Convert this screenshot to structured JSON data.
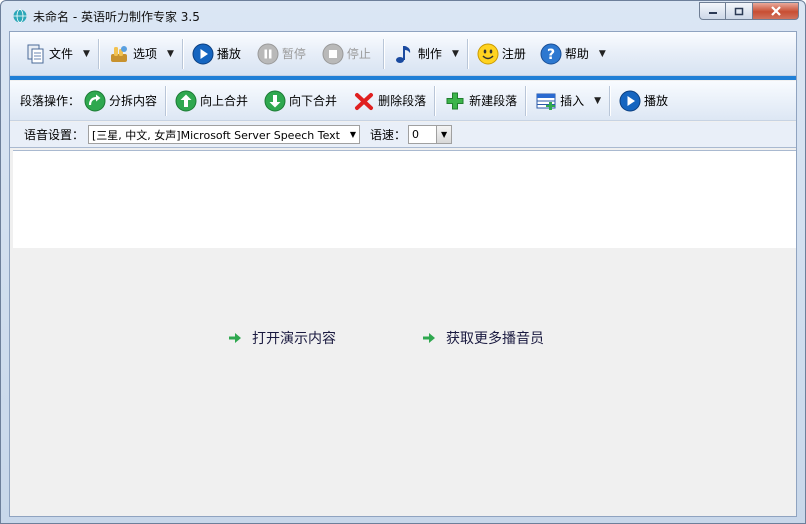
{
  "window": {
    "title": "未命名 - 英语听力制作专家 3.5"
  },
  "toolbar_main": {
    "file": "文件",
    "options": "选项",
    "play": "播放",
    "pause": "暂停",
    "stop": "停止",
    "make": "制作",
    "register": "注册",
    "help": "帮助"
  },
  "toolbar_paragraph": {
    "label": "段落操作：",
    "split": "分拆内容",
    "merge_up": "向上合并",
    "merge_down": "向下合并",
    "delete": "删除段落",
    "new": "新建段落",
    "insert": "插入",
    "play": "播放"
  },
  "voice_settings": {
    "label": "语音设置：",
    "voice_value": "[三星, 中文, 女声]Microsoft Server Speech Text to",
    "speed_label": "语速：",
    "speed_value": "0"
  },
  "links": {
    "open_demo": "打开演示内容",
    "more_voices": "获取更多播音员"
  },
  "colors": {
    "accent_blue": "#1f7fd6",
    "play_blue": "#1565c0",
    "go_green": "#2fa84f",
    "delete_red": "#e02020"
  }
}
